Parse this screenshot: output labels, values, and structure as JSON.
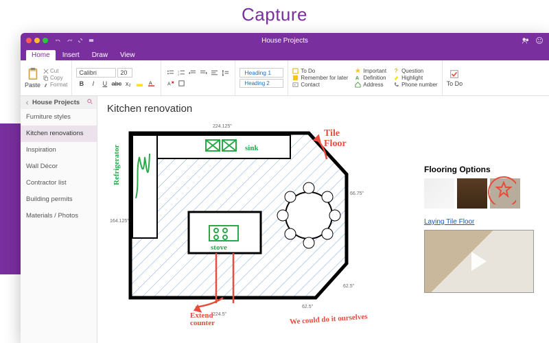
{
  "hero": {
    "title": "Capture"
  },
  "titlebar": {
    "document": "House Projects"
  },
  "ribbon": {
    "tabs": [
      "Home",
      "Insert",
      "Draw",
      "View"
    ],
    "active_tab": "Home",
    "paste": "Paste",
    "cut": "Cut",
    "copy": "Copy",
    "format": "Format",
    "font_name": "Calibri",
    "font_size": "20",
    "heading1": "Heading 1",
    "heading2": "Heading 2",
    "tags": {
      "todo": "To Do",
      "important": "Important",
      "question": "Question",
      "remember": "Remember for later",
      "definition": "Definition",
      "highlight": "Highlight",
      "contact": "Contact",
      "address": "Address",
      "phone": "Phone number"
    },
    "todo_btn": "To Do"
  },
  "sidebar": {
    "notebook": "House Projects",
    "pages": [
      "Furniture styles",
      "Kitchen renovations",
      "Inspiration",
      "Wall Décor",
      "Contractor list",
      "Building permits",
      "Materials / Photos"
    ],
    "active_page": "Kitchen renovations"
  },
  "page": {
    "title": "Kitchen renovation",
    "dimensions": {
      "top": "224.125\"",
      "left": "164.125\"",
      "bottom": "224.5\"",
      "right_upper": "66.75\"",
      "right_lower": "62.5\"",
      "notch": "62.5\""
    },
    "ink": {
      "refrigerator": "Refrigerator",
      "sink": "sink",
      "stove": "stove",
      "tile_floor": "Tile Floor",
      "extend": "Extend counter",
      "could_do": "We could do it ourselves"
    },
    "flooring": {
      "heading": "Flooring Options",
      "link": "Laying Tile Floor"
    }
  }
}
